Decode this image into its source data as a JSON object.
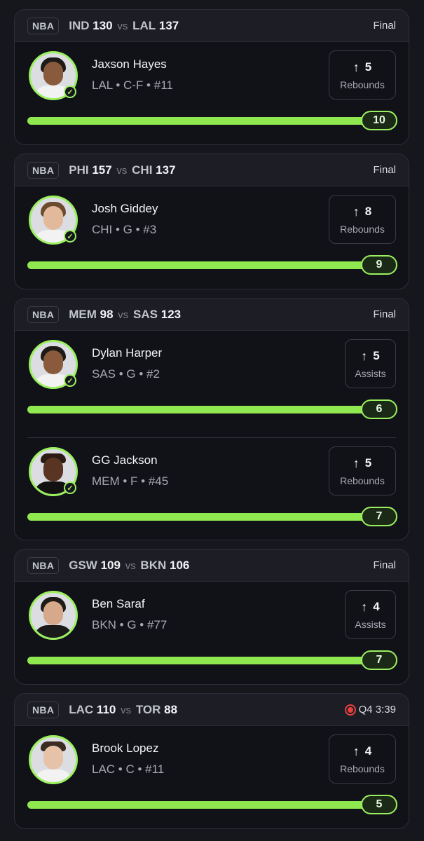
{
  "games": [
    {
      "league": "NBA",
      "home": "IND",
      "home_score": "130",
      "vs": "vs",
      "away": "LAL",
      "away_score": "137",
      "status": "Final",
      "players": [
        {
          "name": "Jaxson Hayes",
          "meta": "LAL • C-F • #11",
          "stat_value": "5",
          "stat_label": "Rebounds",
          "progress_value": "10",
          "progress_fraction": 1.0
        }
      ]
    },
    {
      "league": "NBA",
      "home": "PHI",
      "home_score": "157",
      "vs": "vs",
      "away": "CHI",
      "away_score": "137",
      "status": "Final",
      "players": [
        {
          "name": "Josh Giddey",
          "meta": "CHI • G • #3",
          "stat_value": "8",
          "stat_label": "Rebounds",
          "progress_value": "9",
          "progress_fraction": 1.0
        }
      ]
    },
    {
      "league": "NBA",
      "home": "MEM",
      "home_score": "98",
      "vs": "vs",
      "away": "SAS",
      "away_score": "123",
      "status": "Final",
      "players": [
        {
          "name": "Dylan Harper",
          "meta": "SAS • G • #2",
          "stat_value": "5",
          "stat_label": "Assists",
          "progress_value": "6",
          "progress_fraction": 1.0
        },
        {
          "name": "GG Jackson",
          "meta": "MEM • F • #45",
          "stat_value": "5",
          "stat_label": "Rebounds",
          "progress_value": "7",
          "progress_fraction": 1.0
        }
      ]
    },
    {
      "league": "NBA",
      "home": "GSW",
      "home_score": "109",
      "vs": "vs",
      "away": "BKN",
      "away_score": "106",
      "status": "Final",
      "players": [
        {
          "name": "Ben Saraf",
          "meta": "BKN • G • #77",
          "stat_value": "4",
          "stat_label": "Assists",
          "progress_value": "7",
          "progress_fraction": 1.0
        }
      ]
    },
    {
      "league": "NBA",
      "home": "LAC",
      "home_score": "110",
      "vs": "vs",
      "away": "TOR",
      "away_score": "88",
      "status": "Q4 3:39",
      "live": true,
      "players": [
        {
          "name": "Brook Lopez",
          "meta": "LAC • C • #11",
          "stat_value": "4",
          "stat_label": "Rebounds",
          "progress_value": "5",
          "progress_fraction": 1.0
        }
      ]
    }
  ],
  "colors": {
    "accent": "#9bf060",
    "bar_fill": "#8fe84f",
    "card_bg": "#111118",
    "page_bg": "#16171d",
    "live": "#e84040"
  },
  "icons": {
    "up_arrow": "arrow-up-icon",
    "verified": "check-circle-icon",
    "live": "live-record-icon"
  }
}
